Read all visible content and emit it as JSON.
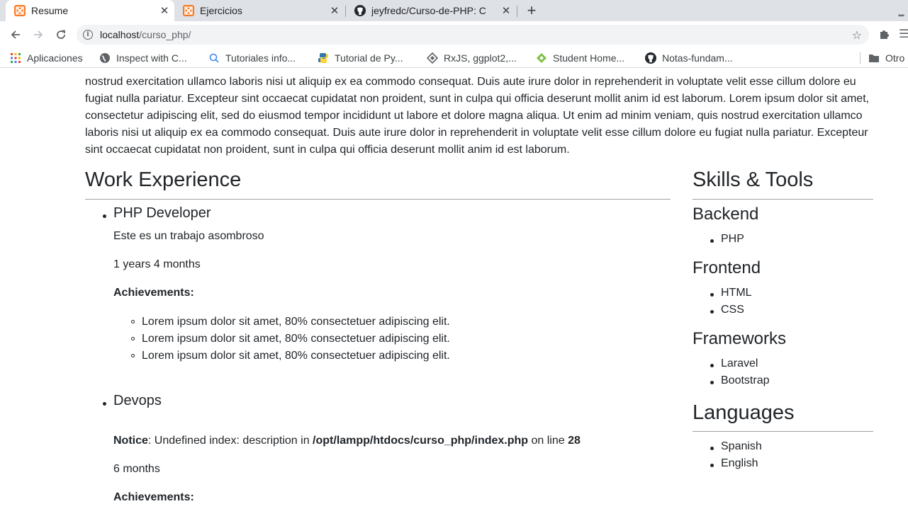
{
  "browser": {
    "tabs": [
      {
        "title": "Resume",
        "active": true
      },
      {
        "title": "Ejercicios",
        "active": false
      },
      {
        "title": "jeyfredc/Curso-de-PHP: C",
        "active": false
      }
    ],
    "url_host": "localhost",
    "url_path": "/curso_php/",
    "bookmarks": [
      {
        "label": "Aplicaciones",
        "icon": "apps-grid-icon"
      },
      {
        "label": "Inspect with C...",
        "icon": "globe-icon"
      },
      {
        "label": "Tutoriales info...",
        "icon": "search-bulb-icon"
      },
      {
        "label": "Tutorial de Py...",
        "icon": "python-icon"
      },
      {
        "label": "RxJS, ggplot2,...",
        "icon": "diamond-icon"
      },
      {
        "label": "Student Home...",
        "icon": "leaf-icon"
      },
      {
        "label": "Notas-fundam...",
        "icon": "github-icon"
      },
      {
        "label": "Otro",
        "icon": "folder-icon"
      }
    ]
  },
  "page": {
    "intro": "nostrud exercitation ullamco laboris nisi ut aliquip ex ea commodo consequat. Duis aute irure dolor in reprehenderit in voluptate velit esse cillum dolore eu fugiat nulla pariatur. Excepteur sint occaecat cupidatat non proident, sunt in culpa qui officia deserunt mollit anim id est laborum. Lorem ipsum dolor sit amet, consectetur adipiscing elit, sed do eiusmod tempor incididunt ut labore et dolore magna aliqua. Ut enim ad minim veniam, quis nostrud exercitation ullamco laboris nisi ut aliquip ex ea commodo consequat. Duis aute irure dolor in reprehenderit in voluptate velit esse cillum dolore eu fugiat nulla pariatur. Excepteur sint occaecat cupidatat non proident, sunt in culpa qui officia deserunt mollit anim id est laborum.",
    "work_heading": "Work Experience",
    "jobs": [
      {
        "title": "PHP Developer",
        "description": "Este es un trabajo asombroso",
        "duration": "1 years 4 months",
        "achievements_label": "Achievements:",
        "achievements": [
          "Lorem ipsum dolor sit amet, 80% consectetuer adipiscing elit.",
          "Lorem ipsum dolor sit amet, 80% consectetuer adipiscing elit.",
          "Lorem ipsum dolor sit amet, 80% consectetuer adipiscing elit."
        ]
      },
      {
        "title": "Devops",
        "notice_label": "Notice",
        "notice_text": ": Undefined index: description in ",
        "notice_path": "/opt/lampp/htdocs/curso_php/index.php",
        "notice_online": " on line ",
        "notice_line": "28",
        "duration": "6 months",
        "achievements_label": "Achievements:"
      }
    ],
    "skills_heading": "Skills & Tools",
    "skills": [
      {
        "category": "Backend",
        "items": [
          "PHP"
        ]
      },
      {
        "category": "Frontend",
        "items": [
          "HTML",
          "CSS"
        ]
      },
      {
        "category": "Frameworks",
        "items": [
          "Laravel",
          "Bootstrap"
        ]
      }
    ],
    "languages_heading": "Languages",
    "languages": [
      "Spanish",
      "English"
    ]
  }
}
